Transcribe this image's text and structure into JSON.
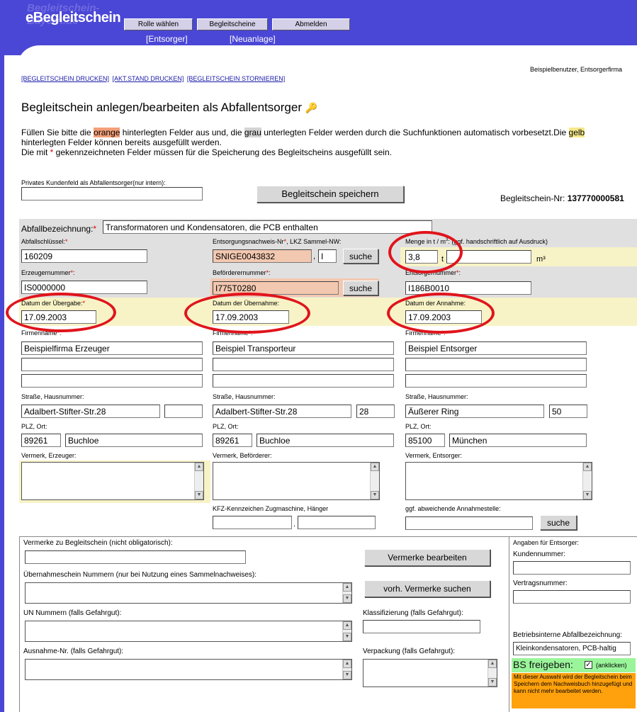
{
  "header": {
    "logo": "eBegleitschein",
    "logo_sub": "Begleitschein-Bayern.de",
    "nav": [
      "Rolle wählen",
      "Begleitscheine",
      "Abmelden"
    ],
    "sub_nav": [
      "[Entsorger]",
      "[Neuanlage]"
    ]
  },
  "user_info": "Beispielbenutzer, Entsorgerfirma",
  "links": [
    "[BEGLEITSCHEIN DRUCKEN]",
    "[AKT.STAND DRUCKEN]",
    "[BEGLEITSCHEIN STORNIEREN]"
  ],
  "page_title": "Begleitschein anlegen/bearbeiten als Abfallentsorger",
  "intro": {
    "p1a": "Füllen Sie bitte die ",
    "orange": "orange",
    "p1b": " hinterlegten Felder aus und, die ",
    "grau": "grau",
    "p1c": " unterlegten Felder werden durch die Suchfunktionen automatisch vorbesetzt.Die ",
    "gelb": "gelb",
    "line2": "hinterlegten Felder können bereits ausgefüllt werden.",
    "line3a": "Die mit ",
    "star": "*",
    "line3b": " gekennzeichneten Felder müssen für die Speicherung des Begleitscheins ausgefüllt sein."
  },
  "kundenfeld_label": "Privates Kundenfeld als Abfallentsorger(nur intern):",
  "save_button": "Begleitschein speichern",
  "bs_nr_label": "Begleitschein-Nr:",
  "bs_nr": "137770000581",
  "abfall": {
    "label": "Abfallbezeichnung:",
    "value": "Transformatoren und Kondensatoren, die PCB enthalten"
  },
  "schluessel": {
    "label": "Abfallschlüssel:",
    "value": "160209"
  },
  "nachweis": {
    "label": "Entsorgungsnachweis-Nr",
    "label2": ", LKZ Sammel-NW:",
    "value": "SNIGE0043832",
    "lkz": "I",
    "search": "suche"
  },
  "menge": {
    "label": "Menge in t / m",
    "label2": ": (ggf. handschriftlich auf Ausdruck)",
    "value": "3,8",
    "unit_t": "t",
    "unit_m": "m³"
  },
  "erzeuger_nr": {
    "label": "Erzeugernummer",
    "value": "IS0000000"
  },
  "befoerderer_nr": {
    "label": "Beförderernummer",
    "value": "I775T0280",
    "search": "suche"
  },
  "entsorger_nr": {
    "label": "Entsorgernummer",
    "value": "I186B0010"
  },
  "dates": {
    "uebergabe_label": "Datum der Übergabe:",
    "uebergabe": "17.09.2003",
    "uebernahme_label": "Datum der Übernahme:",
    "uebernahme": "17.09.2003",
    "annahme_label": "Datum der Annahme:",
    "annahme": "17.09.2003"
  },
  "firm_label": "Firmenname",
  "firms": [
    "Beispielfirma Erzeuger",
    "Beispiel Transporteur",
    "Beispiel Entsorger"
  ],
  "street_label": "Straße, Hausnummer:",
  "streets": [
    {
      "s": "Adalbert-Stifter-Str.28",
      "n": ""
    },
    {
      "s": "Adalbert-Stifter-Str.28",
      "n": "28"
    },
    {
      "s": "Äußerer Ring",
      "n": "50"
    }
  ],
  "plz_label": "PLZ, Ort:",
  "plz": [
    {
      "p": "89261",
      "o": "Buchloe"
    },
    {
      "p": "89261",
      "o": "Buchloe"
    },
    {
      "p": "85100",
      "o": "München"
    }
  ],
  "vermerk_labels": [
    "Vermerk, Erzeuger:",
    "Vermerk, Beförderer:",
    "Vermerk, Entsorger:"
  ],
  "kfz_label": "KFZ-Kennzeichen Zugmaschine, Hänger",
  "kfz_sep": ".",
  "annahmestelle_label": "ggf. abweichende Annahmestelle:",
  "annahmestelle_search": "suche",
  "bottom": {
    "vermerke_label": "Vermerke zu Begleitschein (nicht obligatorisch):",
    "vermerke_btn": "Vermerke bearbeiten",
    "uebernahme_label": "Übernahmeschein Nummern (nur bei Nutzung eines Sammelnachweises):",
    "vorh_btn": "vorh. Vermerke suchen",
    "un_label": "UN Nummern (falls Gefahrgut):",
    "klass_label": "Klassifizierung (falls Gefahrgut):",
    "ausnahme_label": "Ausnahme-Nr. (falls Gefahrgut):",
    "verpackung_label": "Verpackung (falls Gefahrgut):"
  },
  "side": {
    "title": "Angaben für Entsorger:",
    "kunden_label": "Kundennummer:",
    "vertrag_label": "Vertragsnummer:",
    "intern_label": "Betriebsinterne Abfallbezeichnung:",
    "intern_value": "Kleinkondensatoren, PCB-haltig",
    "freigeben_label": "BS freigeben:",
    "freigeben_hint": "(anklicken)",
    "note": "Mit dieser Auswahl wird der Begleitschein beim Speichern dem Nachweisbuch hinzugefügt und kann nicht mehr bearbeitet werden."
  },
  "colors": {
    "accent": "#4b47d6",
    "orange": "#f3c8b0",
    "gray": "#e0e0e0",
    "yellow": "#f7f3c6",
    "green": "#9af59a",
    "note": "#ffa10c",
    "circle": "#e0141c"
  }
}
